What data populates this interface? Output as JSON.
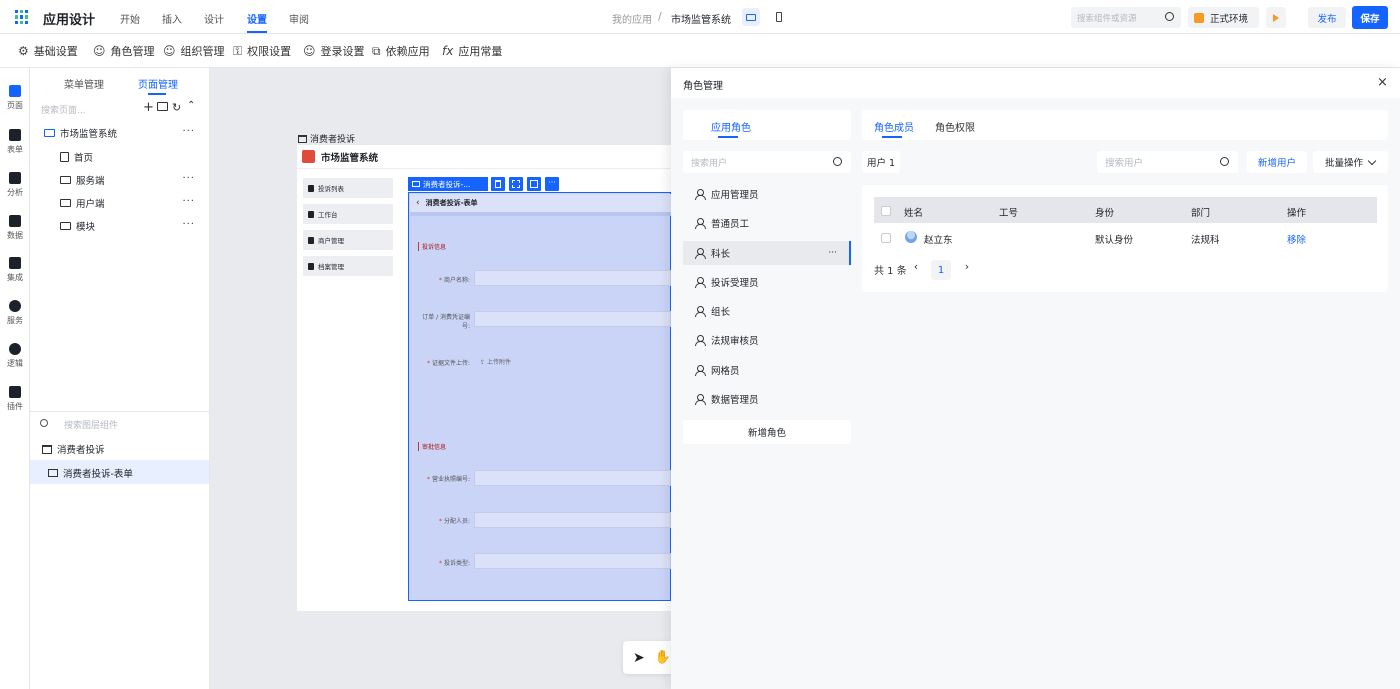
{
  "header": {
    "app_title": "应用设计",
    "menu": [
      "开始",
      "插入",
      "设计",
      "设置",
      "审阅"
    ],
    "active_menu": "设置",
    "breadcrumb_root": "我的应用",
    "breadcrumb_sep": "/",
    "breadcrumb_current": "市场监管系统",
    "search_placeholder": "搜索组件或资源",
    "env_label": "正式环境",
    "publish_label": "发布",
    "save_label": "保存"
  },
  "toolbar": {
    "items": [
      "基础设置",
      "角色管理",
      "组织管理",
      "权限设置",
      "登录设置",
      "依赖应用",
      "应用常量"
    ]
  },
  "rail": {
    "items": [
      "页面",
      "表单",
      "分析",
      "数据",
      "集成",
      "服务",
      "逻辑",
      "插件"
    ]
  },
  "left_panel": {
    "tabs": [
      "菜单管理",
      "页面管理"
    ],
    "active_tab": "页面管理",
    "search_placeholder": "搜索页面...",
    "tree": {
      "root": "市场监管系统",
      "children": [
        "首页",
        "服务端",
        "用户端",
        "模块"
      ]
    },
    "layer_search_placeholder": "搜索图层组件",
    "layers": [
      "消费者投诉",
      "消费者投诉-表单"
    ]
  },
  "canvas": {
    "frame_label": "消费者投诉",
    "app_name": "市场监管系统",
    "nav_items": [
      "投诉列表",
      "工作台",
      "商户管理",
      "档案管理"
    ],
    "selected_chip": "消费者投诉-...",
    "form_title": "消费者投诉-表单",
    "section1": "投诉信息",
    "fields1": [
      "商户名称:",
      "订单 / 消费凭证编号:",
      "证据文件上传:"
    ],
    "upload_label": "上传附件",
    "section2": "审批信息",
    "fields2": [
      "营业执照编号:",
      "分配人员:",
      "投诉类型:"
    ]
  },
  "drawer": {
    "title": "角色管理",
    "close": "×",
    "roles_tab": "应用角色",
    "user_search_placeholder": "搜索用户",
    "roles": [
      "应用管理员",
      "普通员工",
      "科长",
      "投诉受理员",
      "组长",
      "法规审核员",
      "网格员",
      "数据管理员"
    ],
    "selected_role": "科长",
    "add_role_label": "新增角色",
    "right_tabs": [
      "角色成员",
      "角色权限"
    ],
    "active_right_tab": "角色成员",
    "user_count_label": "用户 1",
    "search_user_placeholder": "搜索用户",
    "add_user_label": "新增用户",
    "batch_label": "批量操作",
    "table": {
      "headers": [
        "姓名",
        "工号",
        "身份",
        "部门",
        "操作"
      ],
      "rows": [
        {
          "name": "赵立东",
          "id": "",
          "identity": "默认身份",
          "dept": "法规科",
          "action": "移除"
        }
      ]
    },
    "pagination": {
      "total_label": "共 1 条",
      "page": "1"
    }
  },
  "colors": {
    "accent": "#1664ff",
    "selection": "#c9d4f7"
  }
}
